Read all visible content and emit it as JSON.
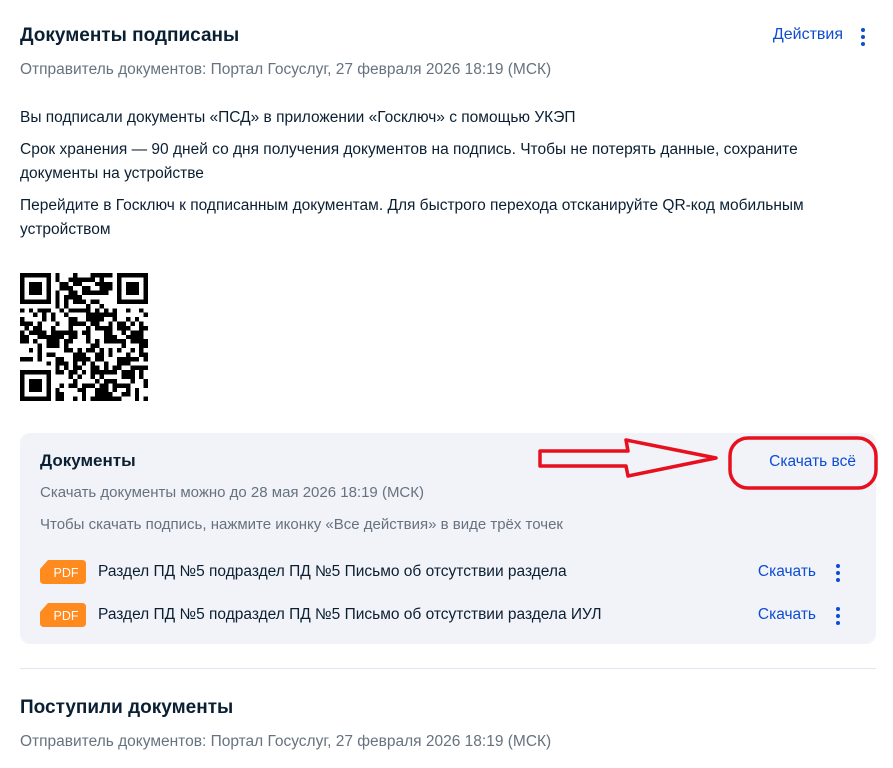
{
  "signed_section": {
    "title": "Документы подписаны",
    "actions_label": "Действия",
    "sender": "Отправитель документов: Портал Госуслуг, 27 февраля 2026 18:19 (МСК)",
    "paragraphs": [
      "Вы подписали документы «ПСД» в приложении «Госключ» с помощью УКЭП",
      "Срок хранения — 90 дней со дня получения документов на подпись. Чтобы не потерять данные, сохраните документы на устройстве",
      "Перейдите в Госключ к подписанным документам. Для быстрого перехода отсканируйте QR-код мобильным устройством"
    ],
    "qr_icon": "qr-code"
  },
  "documents_card": {
    "title": "Документы",
    "download_all_label": "Скачать всё",
    "deadline_note": "Скачать документы можно до 28 мая 2026 18:19 (МСК)",
    "signature_hint": "Чтобы скачать подпись, нажмите иконку «Все действия» в виде трёх точек",
    "files": [
      {
        "type": "PDF",
        "name": "Раздел ПД №5 подраздел ПД №5 Письмо об отсутствии раздела",
        "action": "Скачать"
      },
      {
        "type": "PDF",
        "name": "Раздел ПД №5 подраздел ПД №5 Письмо об отсутствии раздела ИУЛ",
        "action": "Скачать"
      }
    ]
  },
  "received_section": {
    "title": "Поступили документы",
    "sender": "Отправитель документов: Портал Госуслуг, 27 февраля 2026 18:19 (МСК)"
  },
  "colors": {
    "link": "#0d4cd3",
    "text": "#0b1f33",
    "muted": "#66727f",
    "card_bg": "#f1f3f8",
    "pdf_badge": "#ff8a1e",
    "annotation_red": "#e8101e"
  }
}
